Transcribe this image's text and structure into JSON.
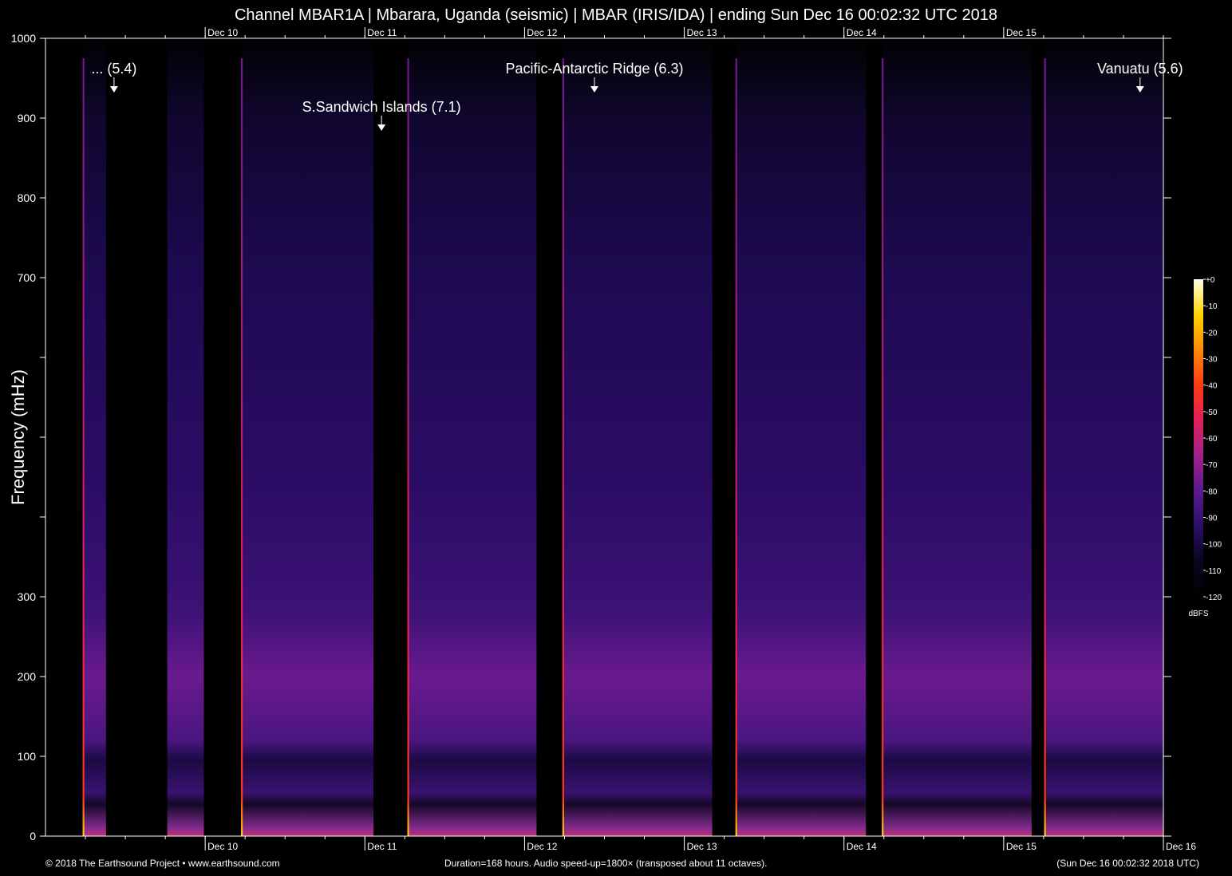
{
  "title": "Channel MBAR1A | Mbarara, Uganda (seismic) | MBAR (IRIS/IDA) | ending Sun Dec 16 00:02:32 UTC 2018",
  "footer": {
    "left": "© 2018 The Earthsound Project • www.earthsound.com",
    "center": "Duration=168 hours. Audio speed-up=1800× (transposed about 11 octaves).",
    "right": "(Sun Dec 16 00:02:32 2018 UTC)"
  },
  "colors": {
    "background": "#000000",
    "axis": "#ffffff",
    "arrow": "#ffffff",
    "colormap": [
      "#000000",
      "#0b0520",
      "#2a0e68",
      "#5a1a8e",
      "#a0228a",
      "#e0205a",
      "#ff3a12",
      "#ff8a08",
      "#ffd400",
      "#ffffe6"
    ]
  },
  "chart_data": {
    "type": "heatmap",
    "title": "Channel MBAR1A | Mbarara, Uganda (seismic) | MBAR (IRIS/IDA) | ending Sun Dec 16 00:02:32 UTC 2018",
    "xlabel": "",
    "ylabel": "Frequency (mHz)",
    "xlim_hours": [
      0,
      168
    ],
    "ylim": [
      0,
      1000
    ],
    "y_ticks": [
      {
        "value": 0,
        "label": "0"
      },
      {
        "value": 100,
        "label": "100"
      },
      {
        "value": 200,
        "label": "200"
      },
      {
        "value": 300,
        "label": "300"
      },
      {
        "value": 400,
        "label": ""
      },
      {
        "value": 500,
        "label": ""
      },
      {
        "value": 600,
        "label": ""
      },
      {
        "value": 700,
        "label": "700"
      },
      {
        "value": 800,
        "label": "800"
      },
      {
        "value": 900,
        "label": "900"
      },
      {
        "value": 1000,
        "label": "1000"
      }
    ],
    "x_ticks": [
      {
        "hour": 24,
        "label": "Dec 10"
      },
      {
        "hour": 48,
        "label": "Dec 11"
      },
      {
        "hour": 72,
        "label": "Dec 12"
      },
      {
        "hour": 96,
        "label": "Dec 13"
      },
      {
        "hour": 120,
        "label": "Dec 14"
      },
      {
        "hour": 144,
        "label": "Dec 15"
      },
      {
        "hour": 168,
        "label": "Dec 16"
      }
    ],
    "minor_x_step_hours": 6,
    "colorbar": {
      "unit": "dBFS",
      "range": [
        -120,
        0
      ],
      "ticks": [
        "+0",
        "-10",
        "-20",
        "-30",
        "-40",
        "-50",
        "-60",
        "-70",
        "-80",
        "-90",
        "-100",
        "-110",
        "-120"
      ]
    },
    "events": [
      {
        "label": "... (5.4)",
        "hour": 10.3
      },
      {
        "label": "S.Sandwich Islands (7.1)",
        "hour": 50.5
      },
      {
        "label": "Pacific-Antarctic Ridge (6.3)",
        "hour": 82.5
      },
      {
        "label": "Vanuatu (5.6)",
        "hour": 164.5
      }
    ],
    "data_gaps_hours": [
      [
        0,
        5.7
      ],
      [
        9.1,
        18.3
      ],
      [
        23.8,
        29.5
      ],
      [
        49.3,
        54.5
      ],
      [
        73.8,
        77.8
      ],
      [
        100.2,
        103.8
      ],
      [
        123.3,
        125.8
      ],
      [
        148.2,
        150.2
      ]
    ],
    "broadband_pulses_hours": [
      5.7,
      29.5,
      54.5,
      77.8,
      103.8,
      125.8,
      150.2
    ]
  }
}
